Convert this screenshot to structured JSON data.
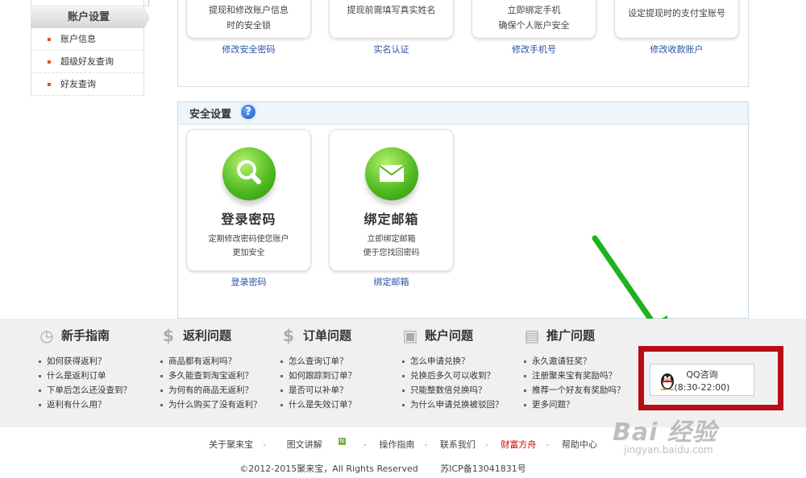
{
  "sidebar": {
    "heading": "账户设置",
    "items": [
      {
        "label": "账户信息"
      },
      {
        "label": "超级好友查询"
      },
      {
        "label": "好友查询"
      }
    ]
  },
  "top_cards": [
    {
      "desc1": "提现和修改账户信息",
      "desc2": "时的安全锁",
      "link": "修改安全密码"
    },
    {
      "desc1": "提现前需填写真实姓名",
      "desc2": "",
      "link": "实名认证"
    },
    {
      "desc1": "立即绑定手机",
      "desc2": "确保个人账户安全",
      "link": "修改手机号"
    },
    {
      "desc1": "设定提现时的支付宝账号",
      "desc2": "",
      "link": "修改收款账户"
    }
  ],
  "security": {
    "title": "安全设置",
    "help_glyph": "?",
    "cards": [
      {
        "title": "登录密码",
        "desc1": "定期修改密码使您账户",
        "desc2": "更加安全",
        "link": "登录密码",
        "icon": "magnifier-icon"
      },
      {
        "title": "绑定邮箱",
        "desc1": "立即绑定邮箱",
        "desc2": "便于您找回密码",
        "link": "绑定邮箱",
        "icon": "envelope-icon"
      }
    ]
  },
  "help": [
    {
      "title": "新手指南",
      "icon": "clock-icon",
      "glyph": "◷",
      "items": [
        "如何获得返利？",
        "什么是返利订单",
        "下单后怎么还没查到？",
        "返利有什么用？"
      ]
    },
    {
      "title": "返利问题",
      "icon": "money-doc-icon",
      "glyph": "$",
      "items": [
        "商品都有返利吗？",
        "多久能查到淘宝返利？",
        "为何有的商品无返利？",
        "为什么购买了没有返利？"
      ]
    },
    {
      "title": "订单问题",
      "icon": "money-bag-icon",
      "glyph": "$",
      "items": [
        "怎么查询订单？",
        "如何跟踪到订单？",
        "是否可以补单？",
        "什么是失效订单？"
      ]
    },
    {
      "title": "账户问题",
      "icon": "gift-icon",
      "glyph": "▣",
      "items": [
        "怎么申请兑换？",
        "兑换后多久可以收到？",
        "只能整数倍兑换吗？",
        "为什么申请兑换被驳回？"
      ]
    },
    {
      "title": "推广问题",
      "icon": "document-icon",
      "glyph": "▤",
      "items": [
        "永久邀请狂奖？",
        "注册聚来宝有奖励吗？",
        "推荐一个好友有奖励吗？",
        "更多问题？"
      ]
    }
  ],
  "qq": {
    "label": "QQ咨询",
    "hours": "(8:30-22:00)"
  },
  "footer": {
    "links": [
      "关于聚来宝",
      "图文讲解",
      "操作指南",
      "联系我们",
      "财富方舟",
      "帮助中心"
    ],
    "new_badge": "N",
    "copyright": "©2012-2015聚来宝，All Rights Reserved",
    "icp": "苏ICP备13041831号"
  },
  "watermark": {
    "logo": "Bai 经验",
    "url": "jingyan.baidu.com"
  },
  "colors": {
    "accent_link": "#2751a3",
    "highlight_box": "#b70d16",
    "arrow": "#1db31d",
    "icon_green": "#4cb81d"
  }
}
